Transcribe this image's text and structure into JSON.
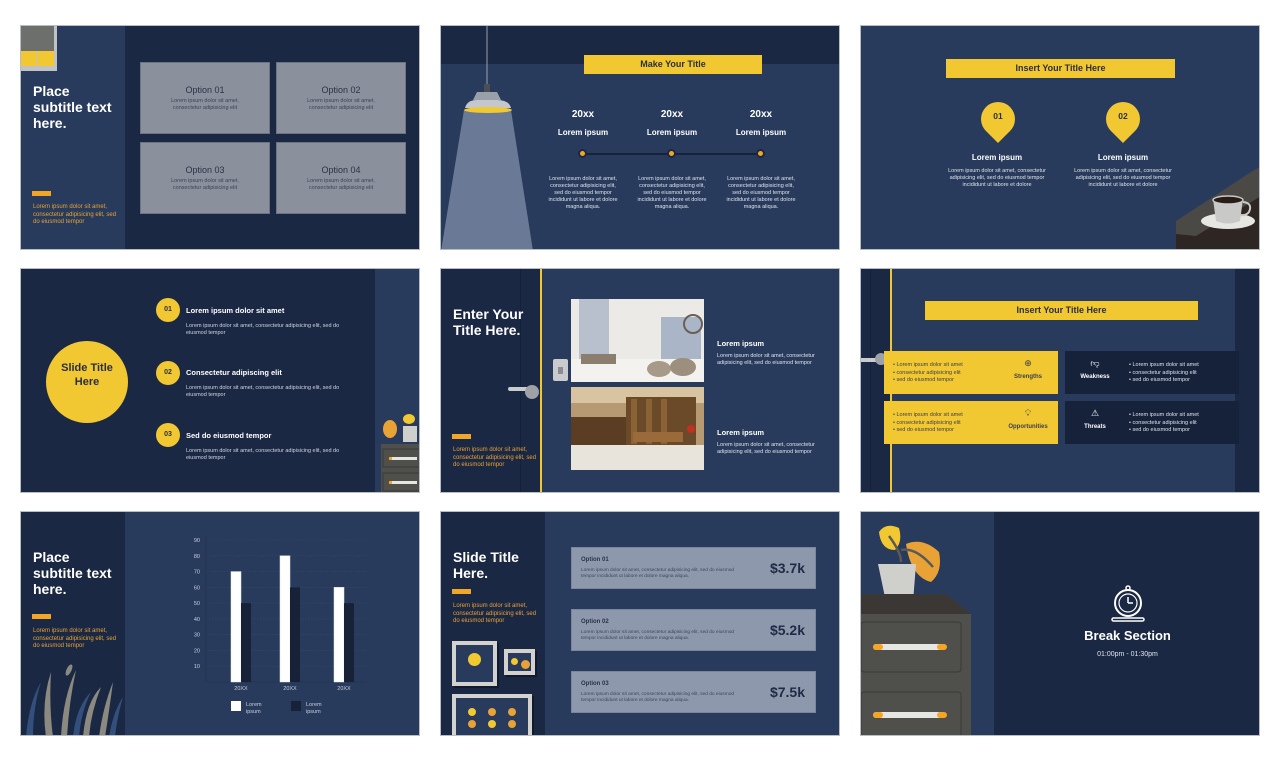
{
  "slides": [
    {
      "id": "options-grid",
      "title": "Place subtitle text here.",
      "body": "Lorem ipsum dolor sit amet, consectetur adipisicing elit, sed do eiusmod tempor",
      "options": [
        {
          "title": "Option 01",
          "desc": "Lorem ipsum dolor sit amet, consectetur adipisicing elit"
        },
        {
          "title": "Option 02",
          "desc": "Lorem ipsum dolor sit amet, consectetur adipisicing elit"
        },
        {
          "title": "Option 03",
          "desc": "Lorem ipsum dolor sit amet, consectetur adipisicing elit"
        },
        {
          "title": "Option 04",
          "desc": "Lorem ipsum dolor sit amet, consectetur adipisicing elit"
        }
      ]
    },
    {
      "id": "timeline",
      "title": "Make Your Title",
      "steps": [
        {
          "year": "20xx",
          "head": "Lorem ipsum",
          "desc": "Lorem ipsum dolor sit amet, consectetur adipisicing elit, sed do eiusmod tempor incididunt ut labore et dolore magna aliqua."
        },
        {
          "year": "20xx",
          "head": "Lorem ipsum",
          "desc": "Lorem ipsum dolor sit amet, consectetur adipisicing elit, sed do eiusmod tempor incididunt ut labore et dolore magna aliqua."
        },
        {
          "year": "20xx",
          "head": "Lorem ipsum",
          "desc": "Lorem ipsum dolor sit amet, consectetur adipisicing elit, sed do eiusmod tempor incididunt ut labore et dolore magna aliqua."
        }
      ]
    },
    {
      "id": "pins",
      "title": "Insert Your Title Here",
      "pins": [
        {
          "num": "01",
          "head": "Lorem ipsum",
          "desc": "Lorem ipsum dolor sit amet, consectetur adipisicing elit, sed do eiusmod tempor incididunt ut labore et dolore"
        },
        {
          "num": "02",
          "head": "Lorem ipsum",
          "desc": "Lorem ipsum dolor sit amet, consectetur adipisicing elit, sed do eiusmod tempor incididunt ut labore et dolore"
        }
      ]
    },
    {
      "id": "numbered-list",
      "title": "Slide Title Here",
      "items": [
        {
          "num": "01",
          "head": "Lorem ipsum dolor sit amet",
          "desc": "Lorem ipsum dolor sit amet, consectetur adipisicing elit, sed do eiusmod tempor"
        },
        {
          "num": "02",
          "head": "Consectetur adipiscing elit",
          "desc": "Lorem ipsum dolor sit amet, consectetur adipisicing elit, sed do eiusmod tempor"
        },
        {
          "num": "03",
          "head": "Sed do eiusmod tempor",
          "desc": "Lorem ipsum dolor sit amet, consectetur adipisicing elit, sed do eiusmod tempor"
        }
      ]
    },
    {
      "id": "photos",
      "title": "Enter Your Title Here.",
      "body": "Lorem ipsum dolor sit amet, consectetur adipisicing elit, sed do eiusmod tempor",
      "items": [
        {
          "head": "Lorem ipsum",
          "desc": "Lorem ipsum dolor sit amet, consectetur adipisicing elit, sed do eiusmod tempor"
        },
        {
          "head": "Lorem ipsum",
          "desc": "Lorem ipsum dolor sit amet, consectetur adipisicing elit, sed do eiusmod tempor"
        }
      ]
    },
    {
      "id": "swot",
      "title": "Insert Your Title Here",
      "quadrants": [
        {
          "label": "Strengths",
          "icon": "target-icon",
          "bullets": [
            "Lorem ipsum dolor sit amet",
            "consectetur adipisicing elit",
            "sed do eiusmod tempor"
          ]
        },
        {
          "label": "Weakness",
          "icon": "thumbs-down-icon",
          "bullets": [
            "Lorem ipsum dolor sit amet",
            "consectetur adipisicing elit",
            "sed do eiusmod tempor"
          ]
        },
        {
          "label": "Opportunities",
          "icon": "lightbulb-icon",
          "bullets": [
            "Lorem ipsum dolor sit amet",
            "consectetur adipisicing elit",
            "sed do eiusmod tempor"
          ]
        },
        {
          "label": "Threats",
          "icon": "warning-icon",
          "bullets": [
            "Lorem ipsum dolor sit amet",
            "consectetur adipisicing elit",
            "sed do eiusmod tempor"
          ]
        }
      ]
    },
    {
      "id": "chart",
      "title": "Place subtitle text here.",
      "body": "Lorem ipsum dolor sit amet, consectetur adipisicing elit, sed do eiusmod tempor"
    },
    {
      "id": "pricing",
      "title": "Slide Title Here.",
      "body": "Lorem ipsum dolor sit amet, consectetur adipisicing elit, sed do eiusmod tempor",
      "options": [
        {
          "title": "Option 01",
          "desc": "Lorem ipsum dolor sit amet, consectetur adipisicing elit, sed do eiusmod tempor incididunt ut labore et dolore magna aliqua.",
          "value": "$3.7k"
        },
        {
          "title": "Option 02",
          "desc": "Lorem ipsum dolor sit amet, consectetur adipisicing elit, sed do eiusmod tempor incididunt ut labore et dolore magna aliqua.",
          "value": "$5.2k"
        },
        {
          "title": "Option 03",
          "desc": "Lorem ipsum dolor sit amet, consectetur adipisicing elit, sed do eiusmod tempor incididunt ut labore et dolore magna aliqua.",
          "value": "$7.5k"
        }
      ]
    },
    {
      "id": "break",
      "title": "Break Section",
      "time": "01:00pm - 01:30pm"
    }
  ],
  "chart_data": {
    "type": "bar",
    "categories": [
      "20XX",
      "20XX",
      "20XX"
    ],
    "series": [
      {
        "name": "Lorem ipsum",
        "color": "#ffffff",
        "values": [
          70,
          80,
          60
        ]
      },
      {
        "name": "Lorem ipsum",
        "color": "#172238",
        "values": [
          50,
          60,
          50
        ]
      }
    ],
    "yticks": [
      10,
      20,
      30,
      40,
      50,
      60,
      70,
      80,
      90
    ],
    "ylim": [
      0,
      90
    ],
    "title": "",
    "xlabel": "",
    "ylabel": "",
    "grid": true,
    "legend": "bottom"
  },
  "colors": {
    "navy": "#1b2844",
    "blue": "#283b5c",
    "yellow": "#f2c832",
    "orange": "#f3a526",
    "gray_card": "#8b909d"
  }
}
